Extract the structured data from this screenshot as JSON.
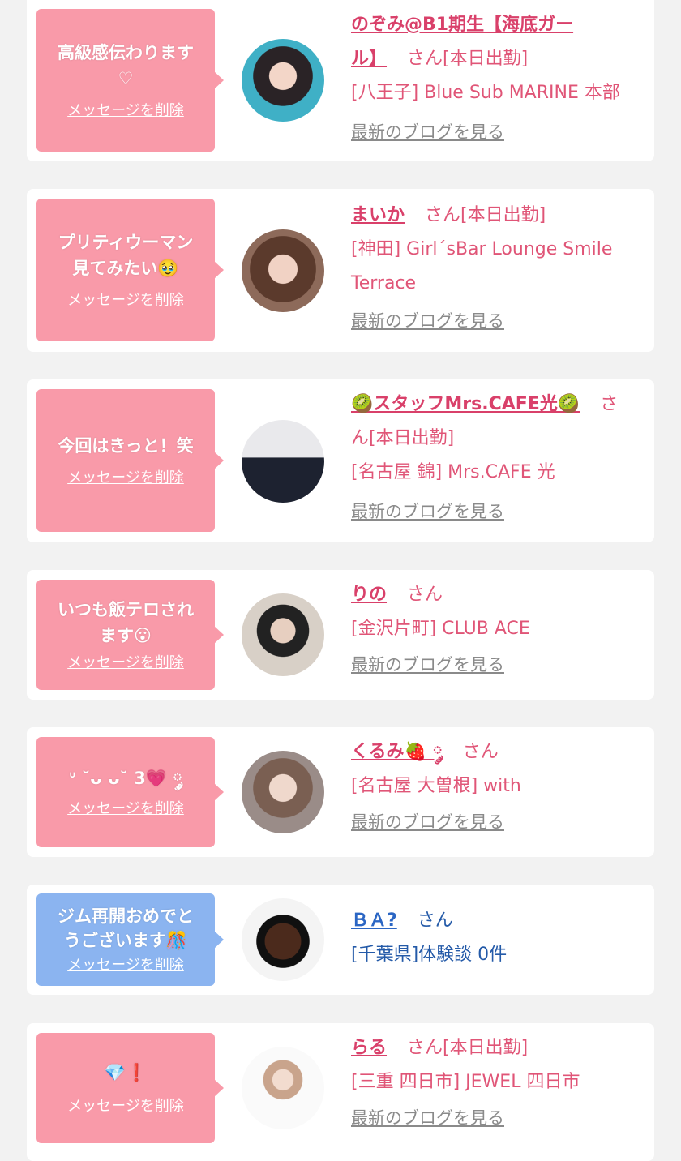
{
  "colors": {
    "pink_bubble": "#f99aa9",
    "blue_bubble": "#8bb4f0",
    "pink_text": "#e05577",
    "blue_text": "#245aa8",
    "link_gray": "#8a8a8a"
  },
  "delete_label": "メッセージを削除",
  "blog_label": "最新のブログを見る",
  "san": "さん",
  "items": [
    {
      "message_line1": "高級感伝わります",
      "message_line2": "♡",
      "name_line1": "のぞみ@B1期生【海底ガー",
      "name_line2": "ル】",
      "suffix": "さん[本日出勤]",
      "shop": "[八王子] Blue Sub MARINE 本部",
      "theme": "pink"
    },
    {
      "message_line1": "プリティウーマン",
      "message_line2": "見てみたい🥹",
      "name": "まいか",
      "suffix": "さん[本日出勤]",
      "shop_line1": "[神田] Girl´sBar Lounge Smile",
      "shop_line2": "Terrace",
      "theme": "pink"
    },
    {
      "message_line1": "今回はきっと！笑",
      "name": "🥝スタッフMrs.CAFE光🥝",
      "suffix_part1": "さ",
      "suffix_part2": "ん[本日出勤]",
      "shop": "[名古屋 錦] Mrs.CAFE 光",
      "theme": "pink"
    },
    {
      "message_line1": "いつも飯テロされ",
      "message_line2": "ます😮",
      "name": "りの",
      "suffix": "さん",
      "shop": "[金沢片町] CLUB ACE",
      "theme": "pink"
    },
    {
      "message_line1": "ᐡ ˘ᴗ ᴗ˘ 3💗 ༘",
      "name": "くるみ🍓 ༘",
      "suffix": "さん",
      "shop": "[名古屋 大曽根] with",
      "theme": "pink"
    },
    {
      "message_line1": "ジム再開おめでと",
      "message_line2": "うございます🎊",
      "name": "ＢＡ?",
      "suffix": "さん",
      "shop": "[千葉県]体験談 0件",
      "theme": "blue"
    },
    {
      "message_line1": "💎❗",
      "name": "らる",
      "suffix": "さん[本日出勤]",
      "shop": "[三重 四日市] JEWEL 四日市",
      "theme": "pink"
    }
  ]
}
